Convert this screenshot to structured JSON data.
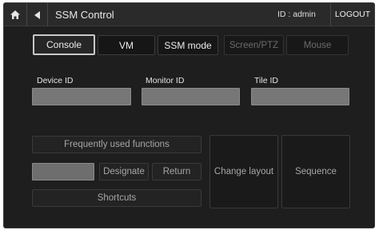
{
  "header": {
    "home_icon": "home-icon",
    "back_icon": "back-arrow-icon",
    "title": "SSM Control",
    "user_id": "ID : admin",
    "logout_label": "LOGOUT"
  },
  "mode_tabs": [
    {
      "label": "Console",
      "state": "selected"
    },
    {
      "label": "VM",
      "state": "normal"
    },
    {
      "label": "SSM mode",
      "state": "normal"
    },
    {
      "label": "Screen/PTZ",
      "state": "disabled"
    },
    {
      "label": "Mouse",
      "state": "disabled"
    }
  ],
  "fields": {
    "device_id": {
      "label": "Device ID",
      "value": ""
    },
    "monitor_id": {
      "label": "Monitor ID",
      "value": ""
    },
    "tile_id": {
      "label": "Tile ID",
      "value": ""
    }
  },
  "functions": {
    "frequently_used_label": "Frequently used functions",
    "designate_value": "",
    "designate_label": "Designate",
    "return_label": "Return",
    "shortcuts_label": "Shortcuts",
    "change_layout_label": "Change layout",
    "sequence_label": "Sequence"
  },
  "colors": {
    "background": "#1e1e1e",
    "topbar": "#2a2a2a",
    "field_fill": "#777777",
    "selected_border": "#c8c8c8"
  }
}
